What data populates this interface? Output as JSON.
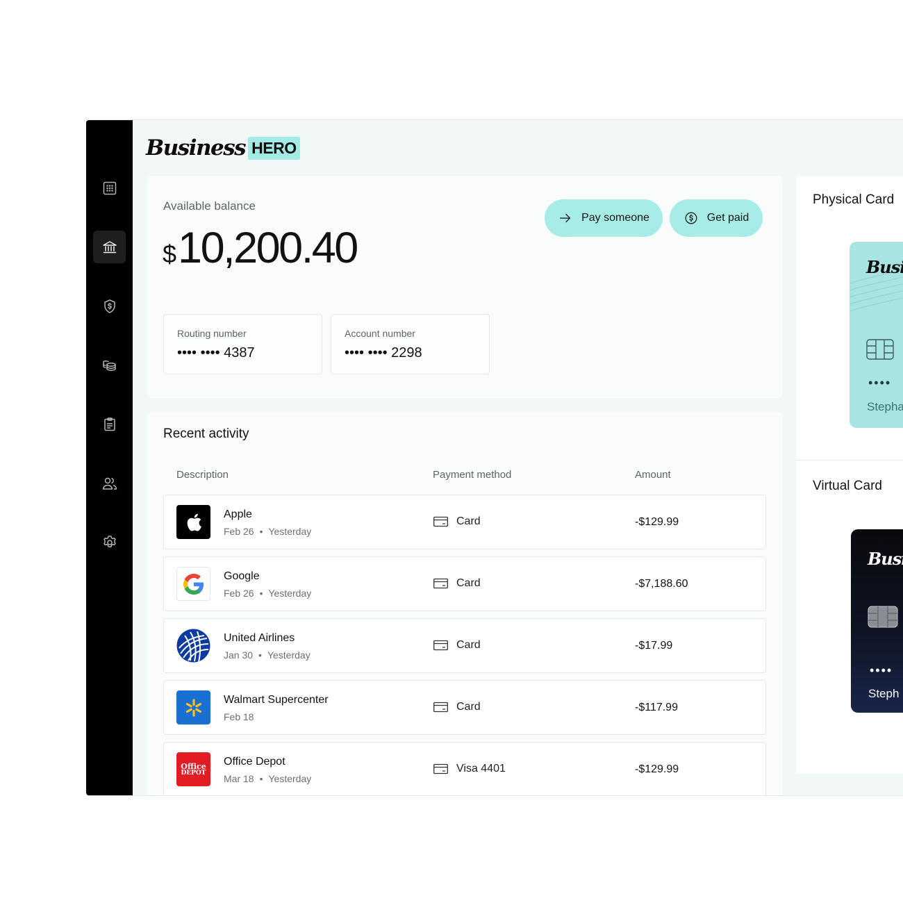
{
  "app": {
    "logo_script": "Business",
    "logo_badge": "HERO"
  },
  "sidebar": {
    "items": [
      {
        "icon": "grid-icon",
        "active": false
      },
      {
        "icon": "bank-icon",
        "active": true
      },
      {
        "icon": "shield-dollar-icon",
        "active": false
      },
      {
        "icon": "coins-icon",
        "active": false
      },
      {
        "icon": "clipboard-icon",
        "active": false
      },
      {
        "icon": "users-icon",
        "active": false
      },
      {
        "icon": "gear-icon",
        "active": false
      }
    ]
  },
  "balance": {
    "label": "Available balance",
    "currency": "$",
    "amount": "10,200.40",
    "pay_label": "Pay someone",
    "get_paid_label": "Get paid",
    "routing_label": "Routing number",
    "routing_value": "•••• •••• 4387",
    "account_label": "Account number",
    "account_value": "•••• •••• 2298"
  },
  "activity": {
    "title": "Recent activity",
    "headers": {
      "description": "Description",
      "payment": "Payment method",
      "amount": "Amount"
    },
    "rows": [
      {
        "name": "Apple",
        "date": "Feb 26",
        "dot": "•",
        "when": "Yesterday",
        "method": "Card",
        "amount": "-$129.99",
        "logo": "apple-logo"
      },
      {
        "name": "Google",
        "date": "Feb 26",
        "dot": "•",
        "when": "Yesterday",
        "method": "Card",
        "amount": "-$7,188.60",
        "logo": "google-logo"
      },
      {
        "name": "United Airlines",
        "date": "Jan 30",
        "dot": "•",
        "when": "Yesterday",
        "method": "Card",
        "amount": "-$17.99",
        "logo": "united-logo"
      },
      {
        "name": "Walmart Supercenter",
        "date": "Feb 18",
        "dot": "",
        "when": "",
        "method": "Card",
        "amount": "-$117.99",
        "logo": "walmart-logo"
      },
      {
        "name": "Office Depot",
        "date": "Mar 18",
        "dot": "•",
        "when": "Yesterday",
        "method": "Visa 4401",
        "amount": "-$129.99",
        "logo": "office-depot-logo",
        "logo_text_1": "Office",
        "logo_text_2": "DEPOT"
      }
    ]
  },
  "cards": {
    "physical_title": "Physical Card",
    "virtual_title": "Virtual Card",
    "physical": {
      "brand": "Busin",
      "dots": "••••",
      "holder": "Stepha"
    },
    "virtual": {
      "brand": "Busin",
      "dots": "••••",
      "holder": "Steph"
    }
  },
  "colors": {
    "accent": "#a7ece6",
    "sidebar": "#000000",
    "background": "#f2f7f7"
  }
}
